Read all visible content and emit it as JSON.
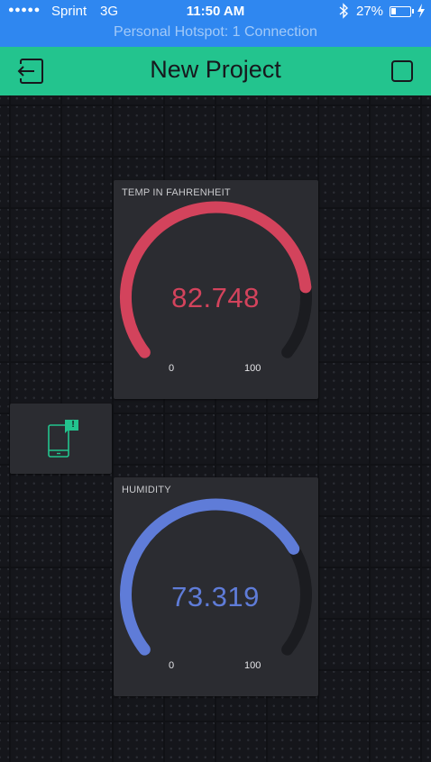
{
  "status_bar": {
    "signal": "●●●●●",
    "carrier": "Sprint",
    "network": "3G",
    "time": "11:50 AM",
    "battery_percent": "27%",
    "battery_level": 0.27,
    "hotspot_text": "Personal Hotspot: 1 Connection",
    "icons": [
      "bluetooth-icon",
      "battery-icon",
      "charging-icon"
    ]
  },
  "header": {
    "title": "New Project",
    "back_icon": "exit-icon",
    "stop_icon": "stop-icon",
    "color": "#23c48e"
  },
  "widgets": [
    {
      "label": "TEMP IN FAHRENHEIT",
      "value": "82.748",
      "numeric_value": 82.748,
      "min": "0",
      "max": "100",
      "color": "#d3435c"
    },
    {
      "label": "HUMIDITY",
      "value": "73.319",
      "numeric_value": 73.319,
      "min": "0",
      "max": "100",
      "color": "#5f7cd8"
    }
  ],
  "notification_widget": {
    "icon": "phone-notification-icon",
    "badge": "!",
    "color": "#23c48e"
  }
}
